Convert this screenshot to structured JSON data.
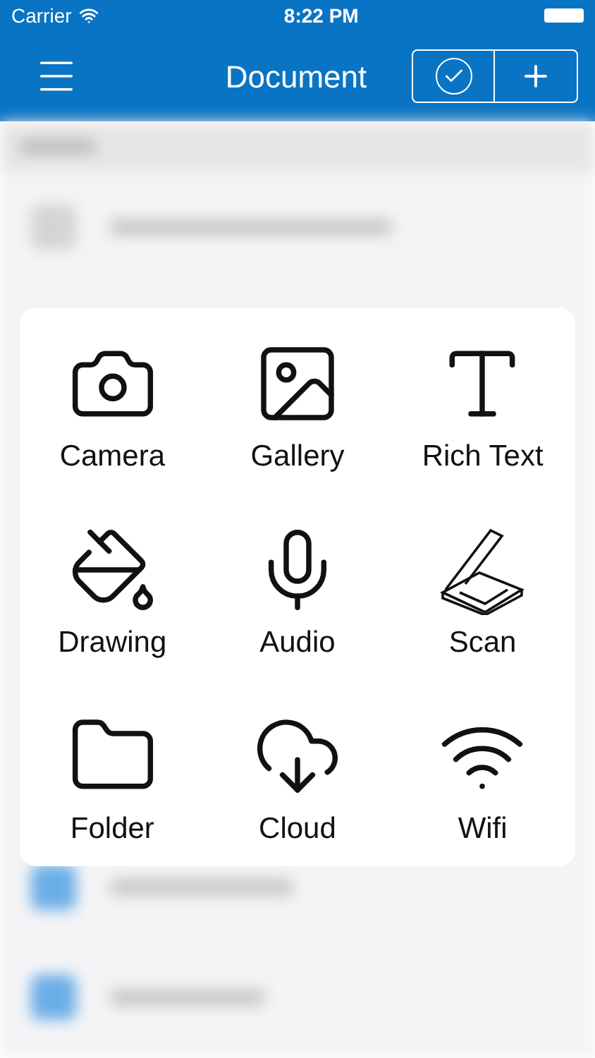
{
  "status_bar": {
    "carrier": "Carrier",
    "time": "8:22 PM"
  },
  "nav_bar": {
    "title": "Document"
  },
  "menu": {
    "items": [
      {
        "kind": "camera",
        "label": "Camera"
      },
      {
        "kind": "gallery",
        "label": "Gallery"
      },
      {
        "kind": "text",
        "label": "Rich Text"
      },
      {
        "kind": "drawing",
        "label": "Drawing"
      },
      {
        "kind": "audio",
        "label": "Audio"
      },
      {
        "kind": "scan",
        "label": "Scan"
      },
      {
        "kind": "folder",
        "label": "Folder"
      },
      {
        "kind": "cloud",
        "label": "Cloud"
      },
      {
        "kind": "wifi",
        "label": "Wifi"
      }
    ]
  }
}
